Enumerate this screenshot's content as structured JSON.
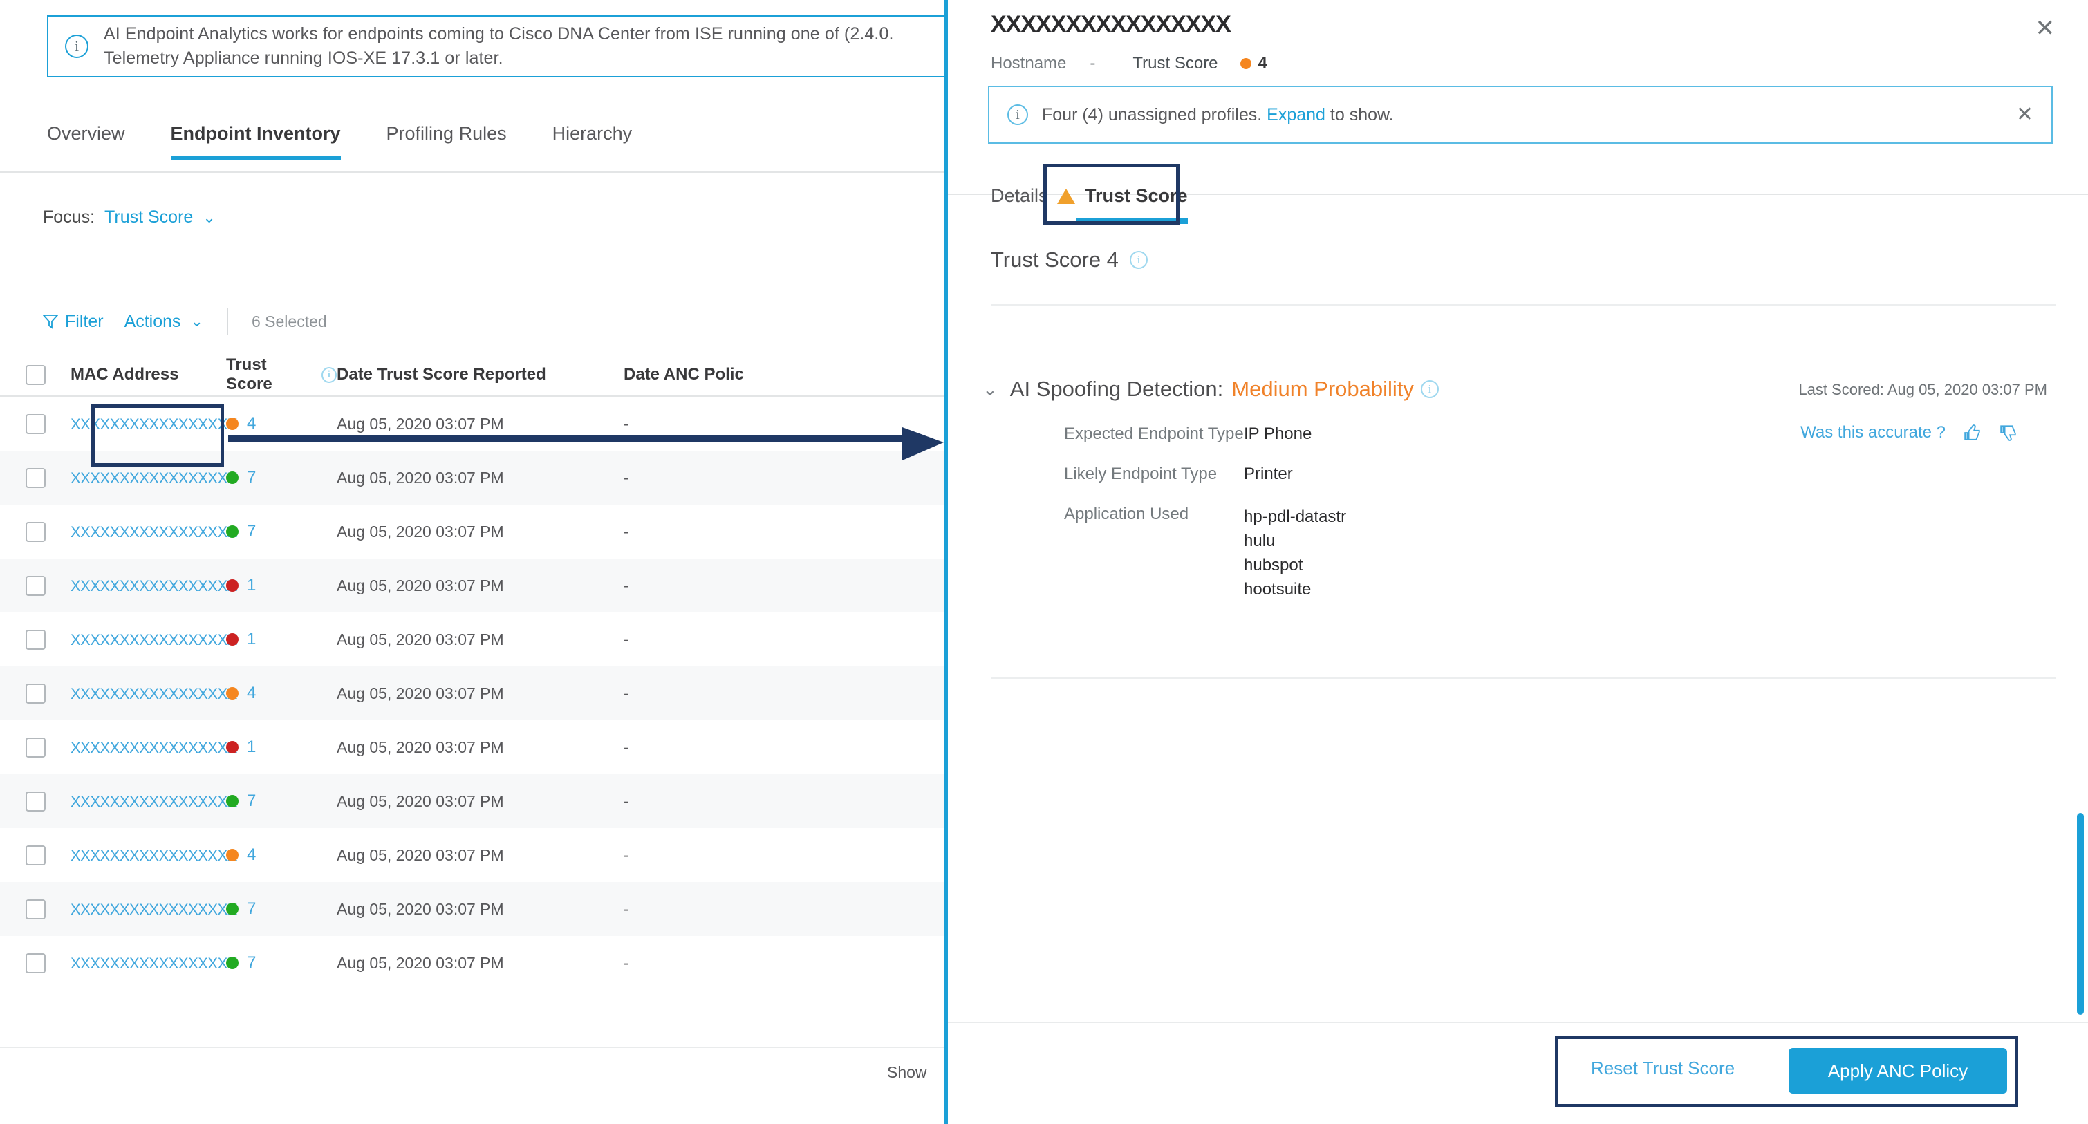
{
  "banner": {
    "icon": "info-icon",
    "text": "AI Endpoint Analytics works for endpoints coming to Cisco DNA Center from ISE running one of (2.4.0.\nTelemetry Appliance running IOS-XE 17.3.1 or later."
  },
  "tabs": [
    {
      "label": "Overview",
      "active": false
    },
    {
      "label": "Endpoint Inventory",
      "active": true
    },
    {
      "label": "Profiling Rules",
      "active": false
    },
    {
      "label": "Hierarchy",
      "active": false
    }
  ],
  "focus": {
    "label": "Focus:",
    "value": "Trust Score",
    "chevron": "chevron-down-icon"
  },
  "toolbar": {
    "filter_label": "Filter",
    "actions_label": "Actions",
    "actions_chevron": "chevron-down-icon",
    "selected_text": "6 Selected"
  },
  "table": {
    "columns": [
      "MAC Address",
      "Trust Score",
      "Date Trust Score Reported",
      "Date ANC Polic"
    ],
    "trust_score_info_icon": "info-icon",
    "rows": [
      {
        "mac": "XXXXXXXXXXXXXXXXX",
        "score": "4",
        "color": "#f5861f",
        "date": "Aug 05, 2020 03:07 PM",
        "anc": "-"
      },
      {
        "mac": "XXXXXXXXXXXXXXXXX",
        "score": "7",
        "color": "#22aa22",
        "date": "Aug 05, 2020 03:07 PM",
        "anc": "-"
      },
      {
        "mac": "XXXXXXXXXXXXXXXXX",
        "score": "7",
        "color": "#22aa22",
        "date": "Aug 05, 2020 03:07 PM",
        "anc": "-"
      },
      {
        "mac": "XXXXXXXXXXXXXXXXX",
        "score": "1",
        "color": "#cc2222",
        "date": "Aug 05, 2020 03:07 PM",
        "anc": "-"
      },
      {
        "mac": "XXXXXXXXXXXXXXXXX",
        "score": "1",
        "color": "#cc2222",
        "date": "Aug 05, 2020 03:07 PM",
        "anc": "-"
      },
      {
        "mac": "XXXXXXXXXXXXXXXXX",
        "score": "4",
        "color": "#f5861f",
        "date": "Aug 05, 2020 03:07 PM",
        "anc": "-"
      },
      {
        "mac": "XXXXXXXXXXXXXXXXX",
        "score": "1",
        "color": "#cc2222",
        "date": "Aug 05, 2020 03:07 PM",
        "anc": "-"
      },
      {
        "mac": "XXXXXXXXXXXXXXXXX",
        "score": "7",
        "color": "#22aa22",
        "date": "Aug 05, 2020 03:07 PM",
        "anc": "-"
      },
      {
        "mac": "XXXXXXXXXXXXXXXXX",
        "score": "4",
        "color": "#f5861f",
        "date": "Aug 05, 2020 03:07 PM",
        "anc": "-"
      },
      {
        "mac": "XXXXXXXXXXXXXXXXX",
        "score": "7",
        "color": "#22aa22",
        "date": "Aug 05, 2020 03:07 PM",
        "anc": "-"
      },
      {
        "mac": "XXXXXXXXXXXXXXXXX",
        "score": "7",
        "color": "#22aa22",
        "date": "Aug 05, 2020 03:07 PM",
        "anc": "-"
      }
    ],
    "footer_text": "Show"
  },
  "panel": {
    "title": "XXXXXXXXXXXXXXXX",
    "close_icon": "close-icon",
    "meta": {
      "hostname_label": "Hostname",
      "hostname_value": "-",
      "trust_label": "Trust Score",
      "trust_value": "4",
      "trust_color": "#f5861f"
    },
    "notice": {
      "icon": "info-icon",
      "text_before": "Four (4) unassigned profiles. ",
      "link": "Expand",
      "text_after": " to show.",
      "close_icon": "close-icon"
    },
    "tabs": [
      {
        "label": "Details",
        "active": false
      },
      {
        "label": "Trust Score",
        "active": true,
        "icon": "warning-triangle-icon"
      }
    ],
    "heading": "Trust Score 4",
    "heading_info_icon": "info-icon",
    "spoofing": {
      "caret_icon": "chevron-down-icon",
      "title": "AI Spoofing Detection:",
      "probability": "Medium Probability",
      "probability_color": "#f0822a",
      "info_icon": "info-icon",
      "last_scored": "Last Scored: Aug 05, 2020 03:07 PM",
      "fields": [
        {
          "key": "Expected Endpoint Type",
          "value": "IP Phone"
        },
        {
          "key": "Likely Endpoint Type",
          "value": "Printer"
        }
      ],
      "application_used_label": "Application Used",
      "applications": [
        "hp-pdl-datastr",
        "hulu",
        "hubspot",
        "hootsuite"
      ],
      "feedback_label": "Was this accurate ?",
      "thumbs_up_icon": "thumbs-up-icon",
      "thumbs_down_icon": "thumbs-down-icon"
    },
    "footer": {
      "reset_label": "Reset Trust Score",
      "apply_label": "Apply ANC Policy",
      "apply_color": "#1ba0d7"
    }
  }
}
